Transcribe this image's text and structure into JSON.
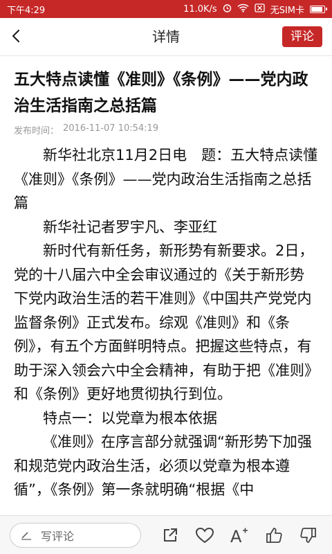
{
  "status": {
    "time": "下午4:29",
    "speed": "11.0K/s",
    "sim": "无SIM卡"
  },
  "nav": {
    "title": "详情",
    "comment_button": "评论"
  },
  "article": {
    "title": "五大特点读懂《准则》《条例》——党内政治生活指南之总括篇",
    "publish_label": "发布时间：",
    "publish_time": "2016-11-07 10:54:19",
    "paragraphs": [
      "新华社北京11月2日电　题：五大特点读懂《准则》《条例》——党内政治生活指南之总括篇",
      "新华社记者罗宇凡、李亚红",
      "新时代有新任务，新形势有新要求。2日，党的十八届六中全会审议通过的《关于新形势下党内政治生活的若干准则》《中国共产党党内监督条例》正式发布。综观《准则》和《条例》，有五个方面鲜明特点。把握这些特点，有助于深入领会六中全会精神，有助于把《准则》和《条例》更好地贯彻执行到位。",
      "特点一：以党章为根本依据",
      "《准则》在序言部分就强调“新形势下加强和规范党内政治生活，必须以党章为根本遵循”，《条例》第一条就明确“根据《中"
    ]
  },
  "bottom": {
    "comment_placeholder": "写评论"
  },
  "colors": {
    "accent": "#c62828"
  }
}
